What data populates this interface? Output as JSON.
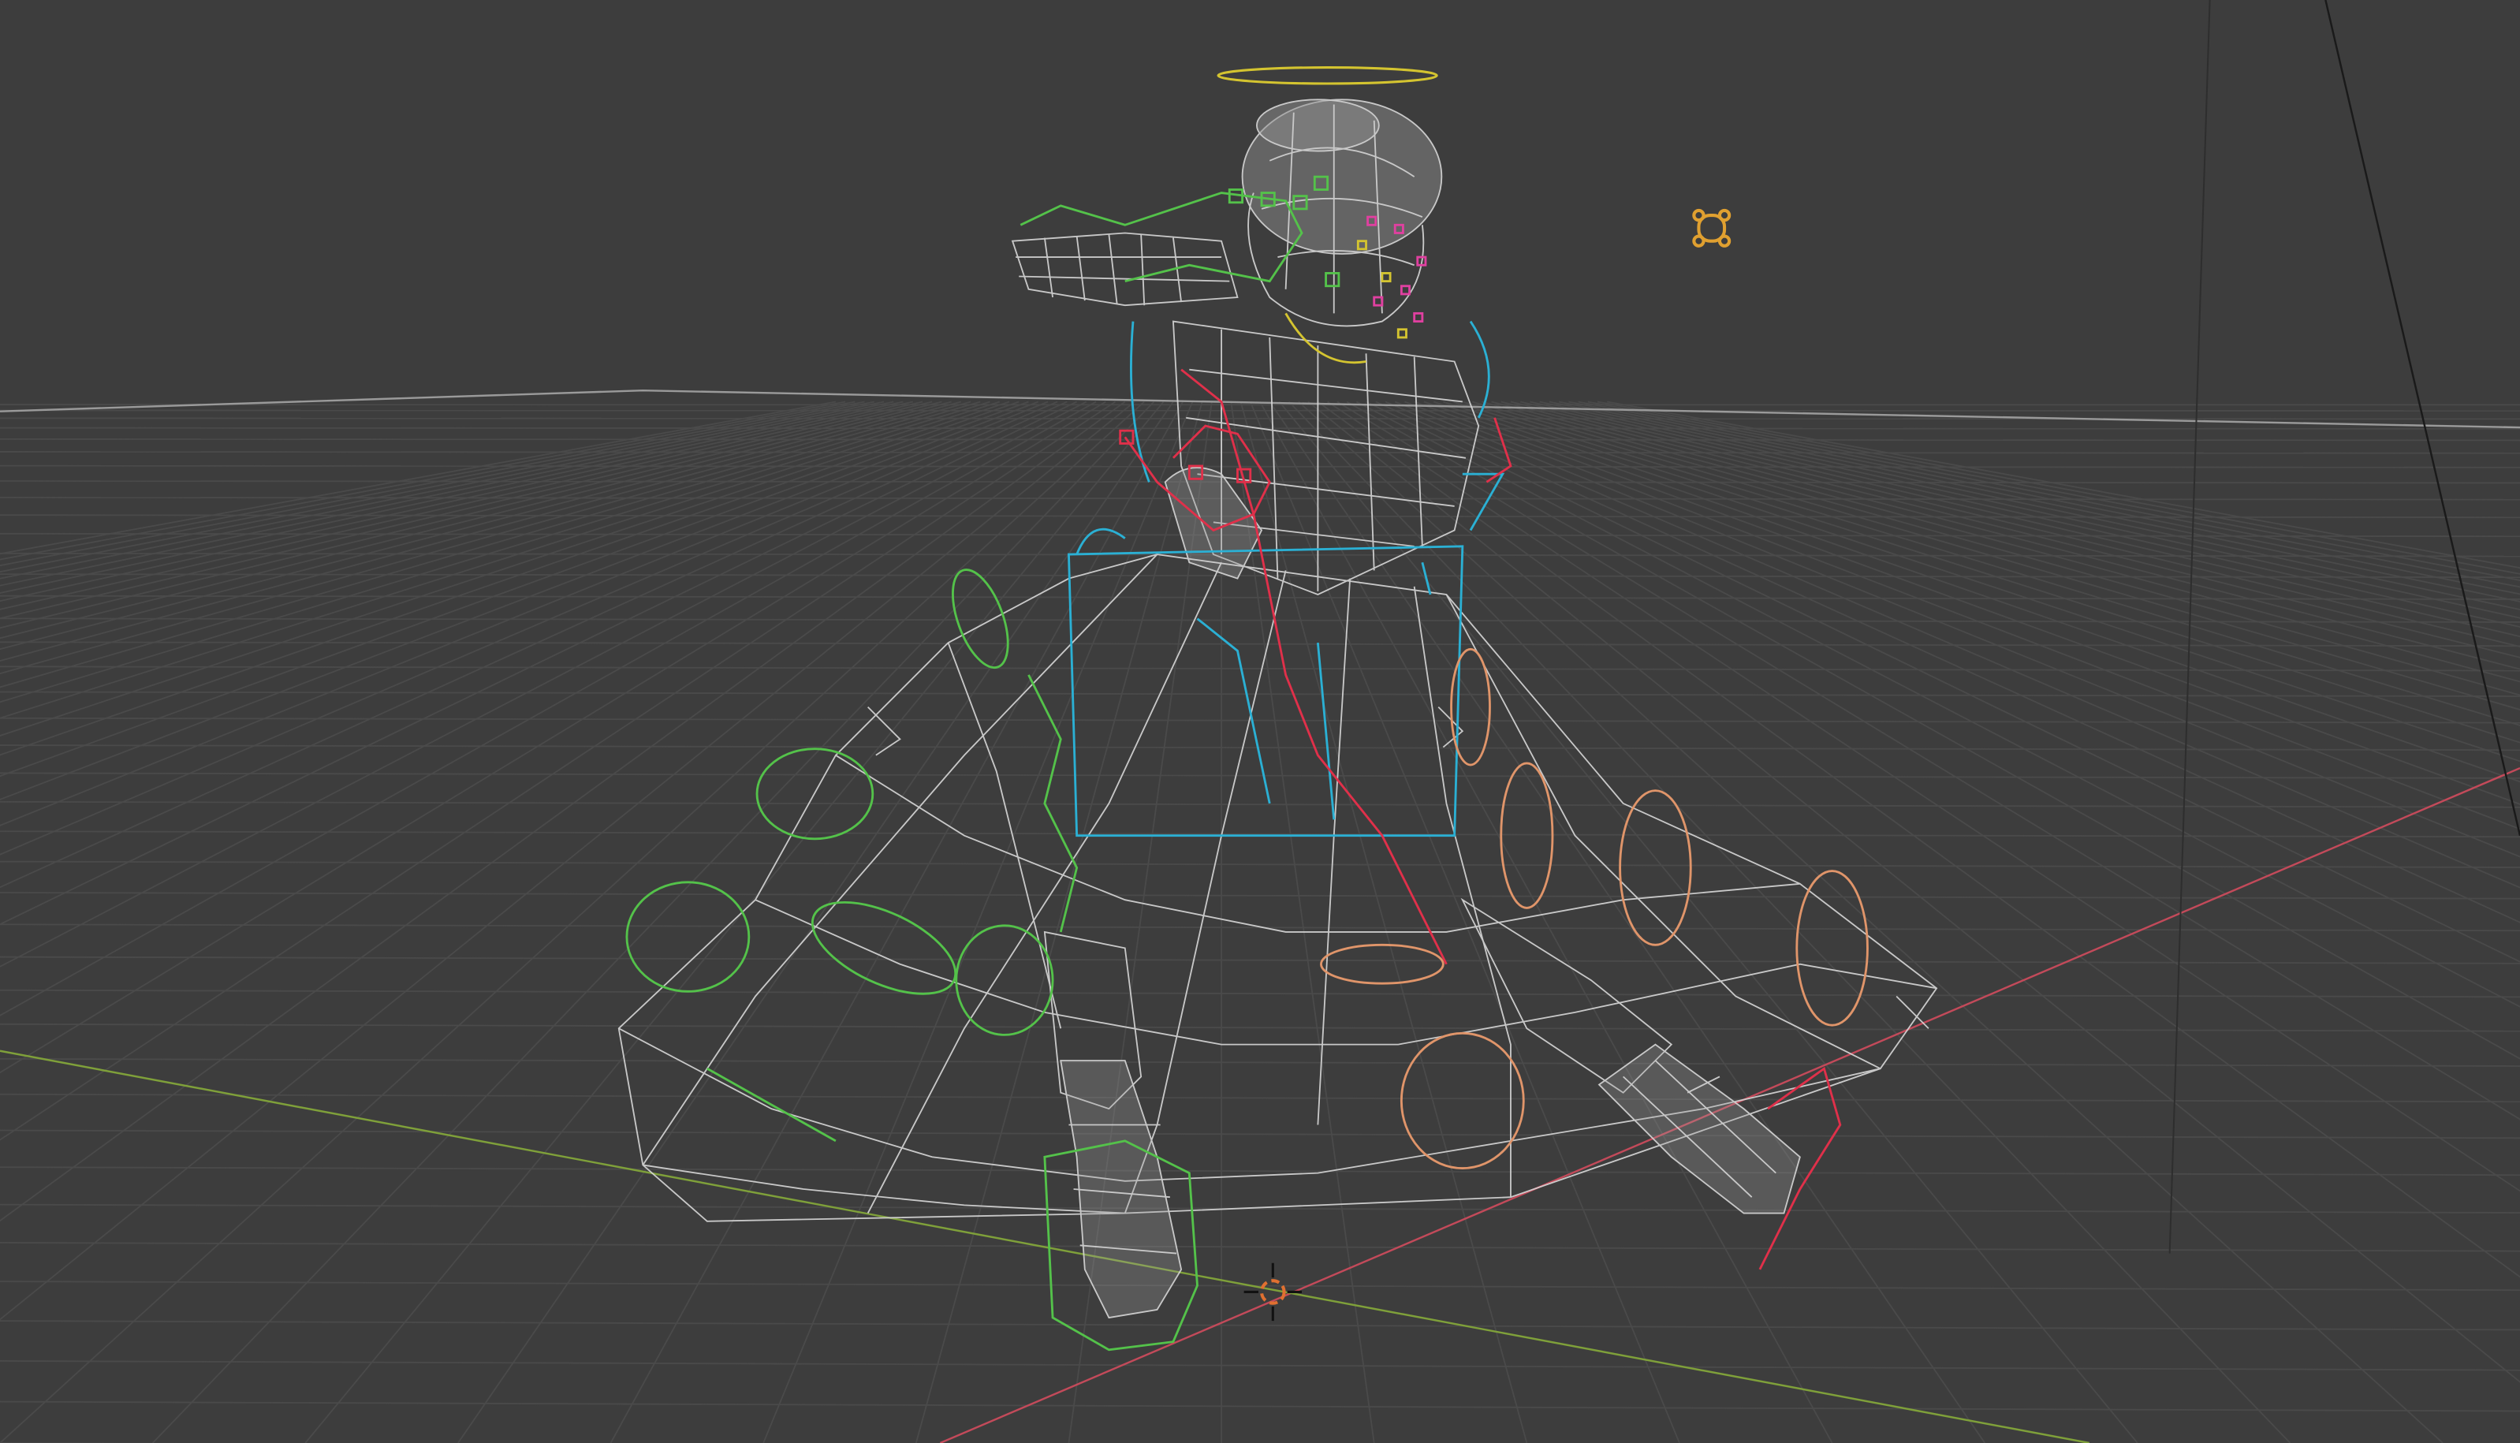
{
  "viewport": {
    "kind": "3D viewport",
    "shading": "wireframe",
    "background_color": "#3d3d3d"
  },
  "colors": {
    "grid_line": "#4a4a4a",
    "horizon_line": "#9a9a9a",
    "x_axis": "#c34a5a",
    "y_axis": "#7fa03a",
    "mesh_wire": "#d8d8d8",
    "rig_green": "#54c24a",
    "rig_cyan": "#2bb0d4",
    "rig_orange": "#e0956a",
    "rig_red": "#e0304a",
    "rig_magenta": "#e040a0",
    "rig_yellow": "#d4c430",
    "light_icon": "#e0a030",
    "cursor_3d": "#e07030",
    "camera_line": "#1a1a1a"
  },
  "icons": {
    "light": "light-icon",
    "cursor": "3d-cursor-icon",
    "halo": "head-control-ring"
  }
}
